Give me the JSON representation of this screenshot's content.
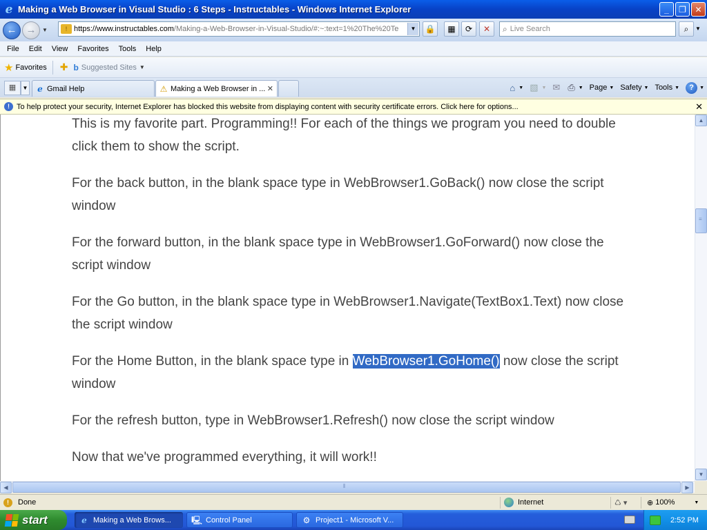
{
  "window": {
    "title": "Making a Web Browser in Visual Studio : 6 Steps - Instructables - Windows Internet Explorer",
    "minimize": "_",
    "restore": "❐",
    "close": "✕"
  },
  "navigation": {
    "address_host": "https://www.instructables.com",
    "address_path": "/Making-a-Web-Browser-in-Visual-Studio/#:~:text=1%20The%20Te",
    "search_placeholder": "Live Search"
  },
  "menu": [
    "File",
    "Edit",
    "View",
    "Favorites",
    "Tools",
    "Help"
  ],
  "favorites_bar": {
    "favorites_label": "Favorites",
    "suggested_sites_label": "Suggested Sites"
  },
  "tabs": [
    {
      "label": "Gmail Help"
    },
    {
      "label": "Making a Web Browser in ..."
    }
  ],
  "command_bar": {
    "page": "Page",
    "safety": "Safety",
    "tools": "Tools",
    "help": "?"
  },
  "info_bar": {
    "message": "To help protect your security, Internet Explorer has blocked this website from displaying content with security certificate errors. Click here for options..."
  },
  "article": {
    "p1": "This is my favorite part. Programming!! For each of the things we program you need to double click them to show the script.",
    "p2": "For the back button, in the blank space type in WebBrowser1.GoBack() now close the script window",
    "p3": "For the forward button, in the blank space type in WebBrowser1.GoForward() now close the script window",
    "p4": "For the Go button, in the blank space type in WebBrowser1.Navigate(TextBox1.Text) now close the script window",
    "p5_before": "For the Home Button, in the blank space type in ",
    "p5_highlight": "WebBrowser1.GoHome()",
    "p5_after": " now close the script window",
    "p6": "For the refresh button, type in WebBrowser1.Refresh() now close the script window",
    "p7": "Now that we've programmed everything, it will work!!"
  },
  "status_bar": {
    "status": "Done",
    "zone": "Internet",
    "zoom": "100%"
  },
  "taskbar": {
    "start_label": "start",
    "buttons": [
      {
        "label": "Making a Web Brows..."
      },
      {
        "label": "Control Panel"
      },
      {
        "label": "Project1 - Microsoft V..."
      }
    ],
    "clock": "2:52 PM"
  }
}
